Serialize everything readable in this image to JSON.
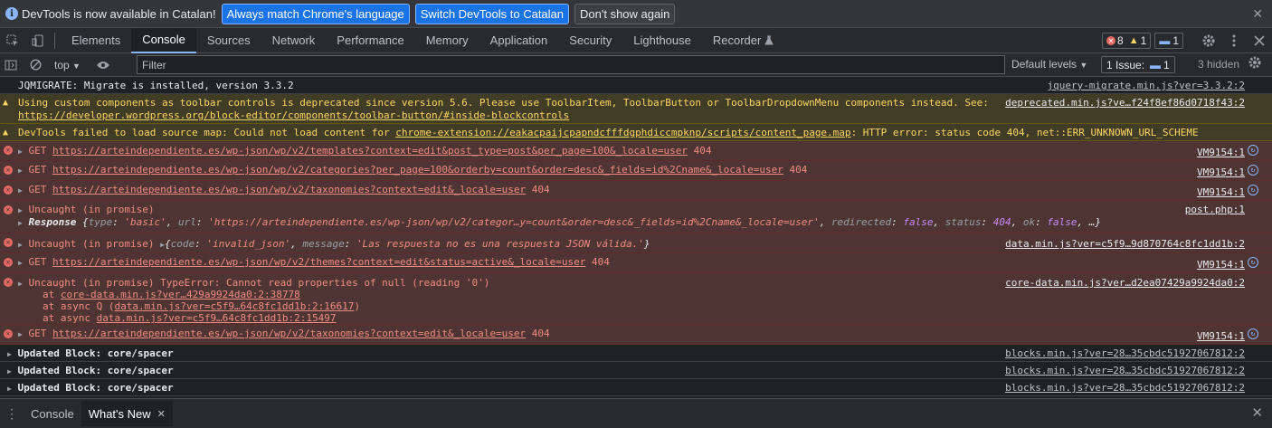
{
  "infobar": {
    "message": "DevTools is now available in Catalan!",
    "btn_match": "Always match Chrome's language",
    "btn_switch": "Switch DevTools to Catalan",
    "btn_dont_show": "Don't show again",
    "info_icon": "i",
    "close_icon": "✕"
  },
  "tabs": {
    "items": [
      "Elements",
      "Console",
      "Sources",
      "Network",
      "Performance",
      "Memory",
      "Application",
      "Security",
      "Lighthouse",
      "Recorder"
    ],
    "active": "Console",
    "errors_count": "8",
    "warnings_count": "1",
    "issues_count": "1"
  },
  "console_toolbar": {
    "context": "top",
    "filter_placeholder": "Filter",
    "default_levels": "Default levels",
    "issues_label": "1 Issue:",
    "issues_count": "1",
    "hidden": "3 hidden"
  },
  "messages": {
    "m0": {
      "text": "JQMIGRATE: Migrate is installed, version 3.3.2",
      "source": "jquery-migrate.min.js?ver=3.3.2:2"
    },
    "m1": {
      "text1": "Using custom components as toolbar controls is deprecated since version 5.6. Please use ToolbarItem, ToolbarButton or ToolbarDropdownMenu components instead. See: ",
      "link": "https://developer.wordpress.org/block-editor/components/toolbar-button/#inside-blockcontrols",
      "source": "deprecated.min.js?ve…f24f8ef86d0718f43:2"
    },
    "m2": {
      "text1": "DevTools failed to load source map: Could not load content for ",
      "link": "chrome-extension://eakacpaijcpapndcfffdgphdiccmpknp/scripts/content_page.map",
      "text2": ": HTTP error: status code 404, net::ERR_UNKNOWN_URL_SCHEME"
    },
    "m3": {
      "method": "GET",
      "url": "https://arteindependiente.es/wp-json/wp/v2/templates?context=edit&post_type=post&per_page=100&_locale=user",
      "status": "404",
      "source": "VM9154:1"
    },
    "m4": {
      "method": "GET",
      "url": "https://arteindependiente.es/wp-json/wp/v2/categories?per_page=100&orderby=count&order=desc&_fields=id%2Cname&_locale=user",
      "status": "404",
      "source": "VM9154:1"
    },
    "m5": {
      "method": "GET",
      "url": "https://arteindependiente.es/wp-json/wp/v2/taxonomies?context=edit&_locale=user",
      "status": "404",
      "source": "VM9154:1"
    },
    "m6": {
      "text": "Uncaught (in promise)",
      "source": "post.php:1",
      "resp_label": "Response",
      "resp_type_key": "type",
      "resp_type_val": "'basic'",
      "resp_url_key": "url",
      "resp_url_val": "'https://arteindependiente.es/wp-json/wp/v2/categor…y=count&order=desc&_fields=id%2Cname&_locale=user'",
      "resp_redir_key": "redirected",
      "resp_redir_val": "false",
      "resp_status_key": "status",
      "resp_status_val": "404",
      "resp_ok_key": "ok",
      "resp_ok_val": "false",
      "resp_more": "…}"
    },
    "m7": {
      "text": "Uncaught (in promise)",
      "code_key": "code",
      "code_val": "'invalid_json'",
      "msg_key": "message",
      "msg_val": "'Las respuesta no es una respuesta JSON válida.'",
      "source": "data.min.js?ver=c5f9…9d870764c8fc1dd1b:2"
    },
    "m8": {
      "method": "GET",
      "url": "https://arteindependiente.es/wp-json/wp/v2/themes?context=edit&status=active&_locale=user",
      "status": "404",
      "source": "VM9154:1"
    },
    "m9": {
      "text": "Uncaught (in promise) TypeError: Cannot read properties of null (reading '0')",
      "source": "core-data.min.js?ver…d2ea07429a9924da0:2",
      "at1_pre": "at ",
      "at1_link": "core-data.min.js?ver…429a9924da0:2:38778",
      "at2_pre": "at async Q (",
      "at2_link": "data.min.js?ver=c5f9…64c8fc1dd1b:2:16617",
      "at2_post": ")",
      "at3_pre": "at async ",
      "at3_link": "data.min.js?ver=c5f9…64c8fc1dd1b:2:15497"
    },
    "m10": {
      "method": "GET",
      "url": "https://arteindependiente.es/wp-json/wp/v2/taxonomies?context=edit&_locale=user",
      "status": "404",
      "source": "VM9154:1"
    },
    "m11": {
      "text": "Updated Block: core/spacer",
      "source": "blocks.min.js?ver=28…35cbdc51927067812:2"
    },
    "m12": {
      "text": "Updated Block: core/spacer",
      "source": "blocks.min.js?ver=28…35cbdc51927067812:2"
    },
    "m13": {
      "text": "Updated Block: core/spacer",
      "source": "blocks.min.js?ver=28…35cbdc51927067812:2"
    }
  },
  "drawer": {
    "tab_console": "Console",
    "tab_whats_new": "What's New"
  },
  "colors": {
    "background": "#202124",
    "error_bg": "#4e3534",
    "warning_bg": "#413c26",
    "accent": "#8ab4f8"
  }
}
